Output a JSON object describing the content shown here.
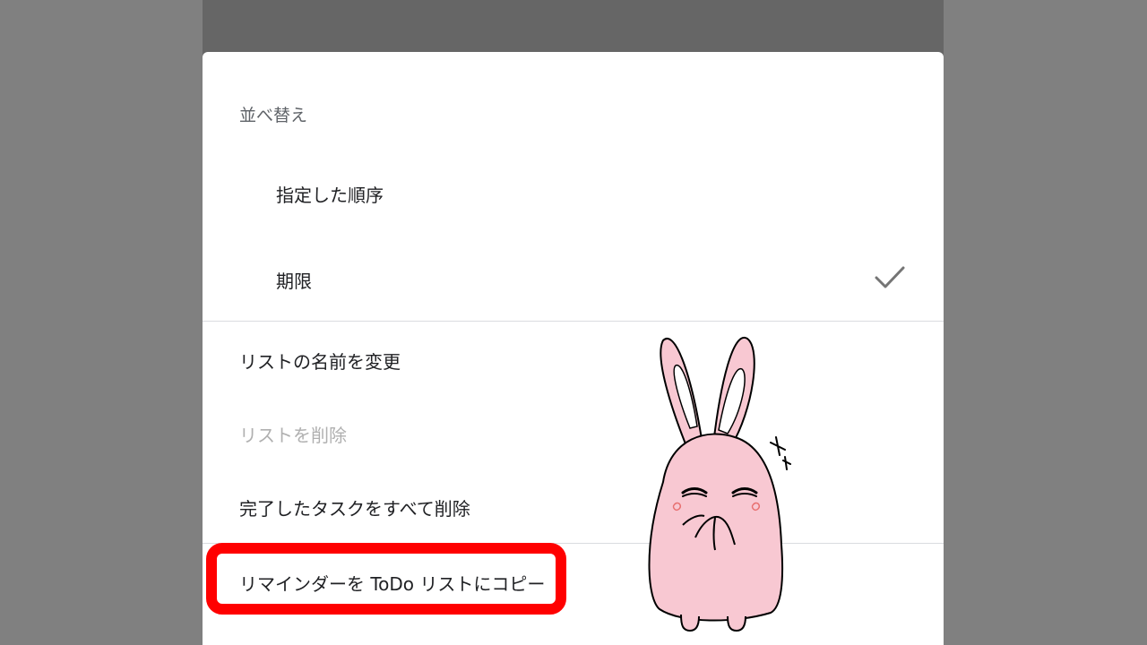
{
  "background": "#808080",
  "dialog": {
    "sort_section": {
      "label": "並べ替え",
      "options": [
        {
          "label": "指定した順序",
          "selected": false
        },
        {
          "label": "期限",
          "selected": true
        }
      ]
    },
    "menu_items": [
      {
        "label": "リストの名前を変更",
        "enabled": true
      },
      {
        "label": "リストを削除",
        "enabled": false
      },
      {
        "label": "完了したタスクをすべて削除",
        "enabled": true
      },
      {
        "label": "リマインダーを ToDo リストにコピー",
        "enabled": true,
        "highlighted": true
      }
    ]
  },
  "icons": {
    "selected_check": "check-icon"
  },
  "colors": {
    "highlight": "#ff0000",
    "scrim": "#666666",
    "disabled_text": "#b0b0b0",
    "bunny_fill": "#f8c8d2"
  }
}
